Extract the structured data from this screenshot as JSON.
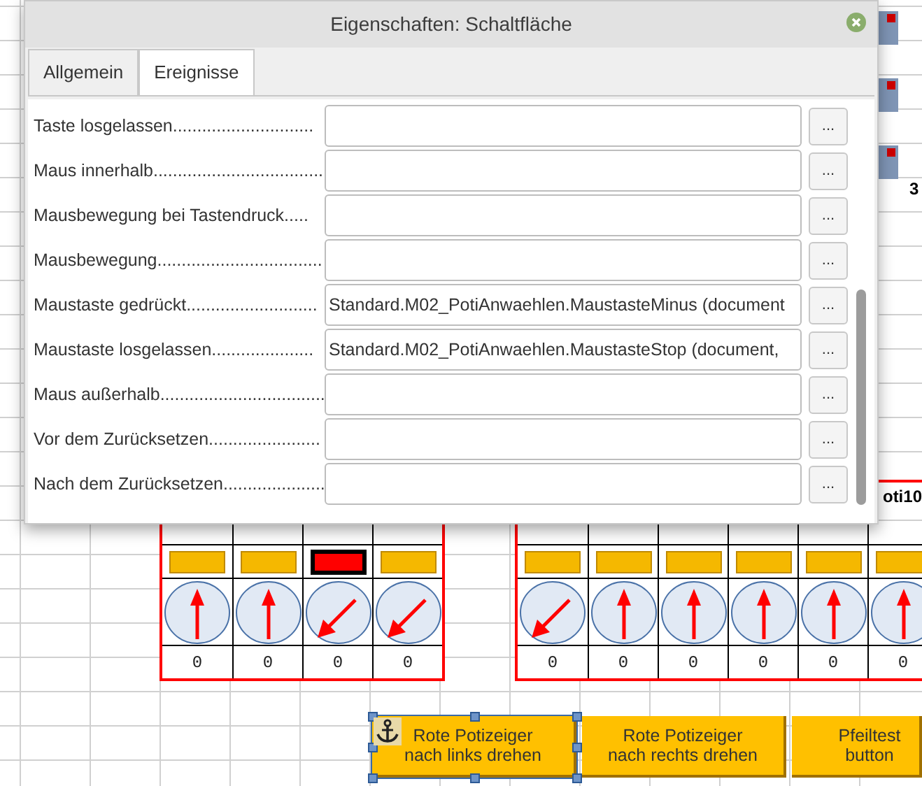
{
  "sheet": {
    "cell_label": "oti10",
    "cell_digit": "3",
    "pot_groups": [
      {
        "pots": [
          {
            "lamp_on": false,
            "kind": "up",
            "value": "0"
          },
          {
            "lamp_on": false,
            "kind": "up",
            "value": "0"
          },
          {
            "lamp_on": true,
            "kind": "downleft",
            "value": "0"
          },
          {
            "lamp_on": false,
            "kind": "downleft",
            "value": "0"
          }
        ]
      },
      {
        "pots": [
          {
            "lamp_on": false,
            "kind": "downleft",
            "value": "0"
          },
          {
            "lamp_on": false,
            "kind": "up",
            "value": "0"
          },
          {
            "lamp_on": false,
            "kind": "up",
            "value": "0"
          },
          {
            "lamp_on": false,
            "kind": "up",
            "value": "0"
          },
          {
            "lamp_on": false,
            "kind": "up",
            "value": "0"
          },
          {
            "lamp_on": false,
            "kind": "up",
            "value": "0"
          }
        ]
      }
    ],
    "buttons": [
      {
        "lines": [
          "Rote Potizeiger",
          "nach links drehen"
        ],
        "selected": true
      },
      {
        "lines": [
          "Rote Potizeiger",
          "nach rechts drehen"
        ],
        "selected": false
      },
      {
        "lines": [
          "Pfeiltest",
          "button"
        ],
        "selected": false
      }
    ]
  },
  "dialog": {
    "title": "Eigenschaften: Schaltfläche",
    "tabs": [
      {
        "label": "Allgemein",
        "selected": false
      },
      {
        "label": "Ereignisse",
        "selected": true
      }
    ],
    "events": [
      {
        "label": "Taste losgelassen.............................",
        "button": "..."
      },
      {
        "label": "Maus innerhalb...................................",
        "button": "..."
      },
      {
        "label": "Mausbewegung bei Tastendruck.....",
        "button": "..."
      },
      {
        "label": "Mausbewegung..................................",
        "button": "..."
      },
      {
        "label": "Maustaste gedrückt...........................",
        "value": "Standard.M02_PotiAnwaehlen.MaustasteMinus (document",
        "button": "..."
      },
      {
        "label": "Maustaste losgelassen.....................",
        "value": "Standard.M02_PotiAnwaehlen.MaustasteStop (document,",
        "button": "..."
      },
      {
        "label": "Maus außerhalb..................................",
        "button": "..."
      },
      {
        "label": "Vor dem Zurücksetzen.......................",
        "button": "..."
      },
      {
        "label": "Nach dem Zurücksetzen.....................",
        "button": "..."
      }
    ]
  }
}
